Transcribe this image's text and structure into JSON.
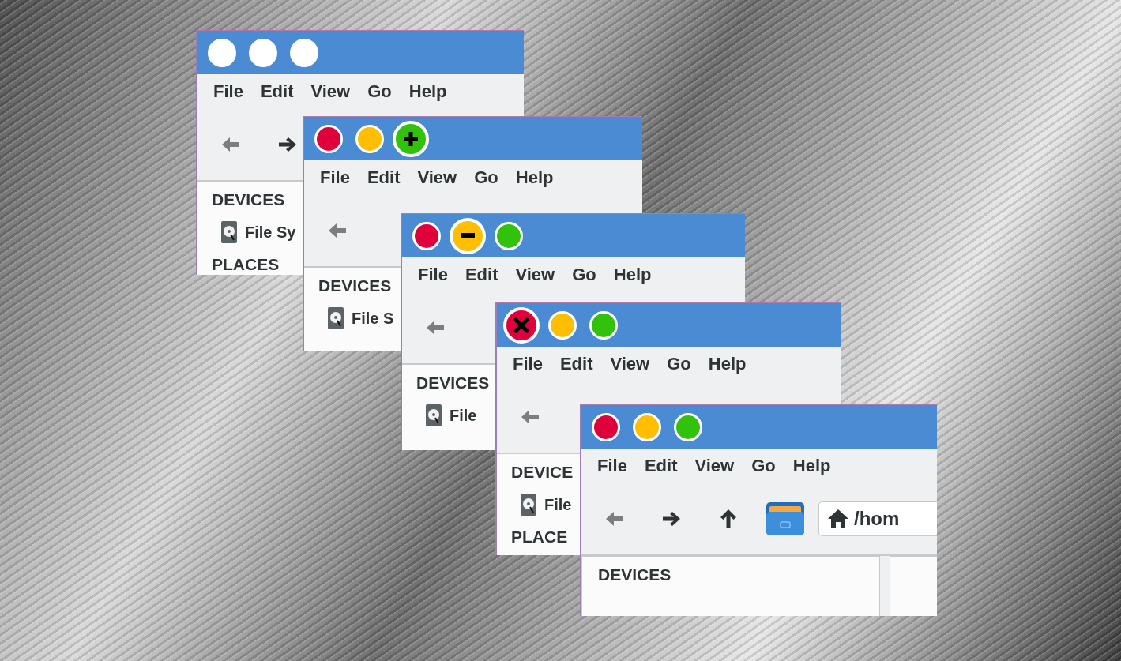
{
  "windows": [
    {
      "active": false,
      "buttons": [
        {
          "kind": "close",
          "hovered": false
        },
        {
          "kind": "minimize",
          "hovered": false
        },
        {
          "kind": "maximize",
          "hovered": false
        }
      ],
      "menu": [
        "File",
        "Edit",
        "View",
        "Go",
        "Help"
      ],
      "toolbar": [
        {
          "kind": "back",
          "disabled": true
        },
        {
          "kind": "forward",
          "disabled": false
        }
      ],
      "sidebar": [
        {
          "heading": "DEVICES",
          "items": [
            "File Sy"
          ]
        },
        {
          "heading": "PLACES"
        }
      ]
    },
    {
      "active": true,
      "buttons": [
        {
          "kind": "close",
          "hovered": false,
          "color": "#e0003c"
        },
        {
          "kind": "minimize",
          "hovered": false,
          "color": "#ffbf00"
        },
        {
          "kind": "maximize",
          "hovered": true,
          "color": "#33c20c"
        }
      ],
      "menu": [
        "File",
        "Edit",
        "View",
        "Go",
        "Help"
      ],
      "toolbar": [
        {
          "kind": "back",
          "disabled": true
        }
      ],
      "sidebar": [
        {
          "heading": "DEVICES",
          "items": [
            "File S"
          ]
        }
      ]
    },
    {
      "active": true,
      "buttons": [
        {
          "kind": "close",
          "hovered": false,
          "color": "#e0003c"
        },
        {
          "kind": "minimize",
          "hovered": true,
          "color": "#ffbf00"
        },
        {
          "kind": "maximize",
          "hovered": false,
          "color": "#33c20c"
        }
      ],
      "menu": [
        "File",
        "Edit",
        "View",
        "Go",
        "Help"
      ],
      "toolbar": [
        {
          "kind": "back",
          "disabled": true
        }
      ],
      "sidebar": [
        {
          "heading": "DEVICES",
          "items": [
            "File"
          ]
        }
      ]
    },
    {
      "active": true,
      "buttons": [
        {
          "kind": "close",
          "hovered": true,
          "color": "#e0003c"
        },
        {
          "kind": "minimize",
          "hovered": false,
          "color": "#ffbf00"
        },
        {
          "kind": "maximize",
          "hovered": false,
          "color": "#33c20c"
        }
      ],
      "menu": [
        "File",
        "Edit",
        "View",
        "Go",
        "Help"
      ],
      "toolbar": [
        {
          "kind": "back",
          "disabled": true
        }
      ],
      "sidebar": [
        {
          "heading": "DEVICE",
          "items": [
            "File"
          ]
        },
        {
          "heading": "PLACE"
        }
      ]
    },
    {
      "active": true,
      "buttons": [
        {
          "kind": "close",
          "hovered": false,
          "color": "#e0003c"
        },
        {
          "kind": "minimize",
          "hovered": false,
          "color": "#ffbf00"
        },
        {
          "kind": "maximize",
          "hovered": false,
          "color": "#33c20c"
        }
      ],
      "menu": [
        "File",
        "Edit",
        "View",
        "Go",
        "Help"
      ],
      "toolbar": [
        {
          "kind": "back",
          "disabled": true
        },
        {
          "kind": "forward",
          "disabled": false
        },
        {
          "kind": "up",
          "disabled": false
        },
        {
          "kind": "folder",
          "disabled": false
        },
        {
          "kind": "location",
          "value": "/hom"
        }
      ],
      "sidebar": [
        {
          "heading": "DEVICES"
        }
      ],
      "content_pane": true
    }
  ]
}
